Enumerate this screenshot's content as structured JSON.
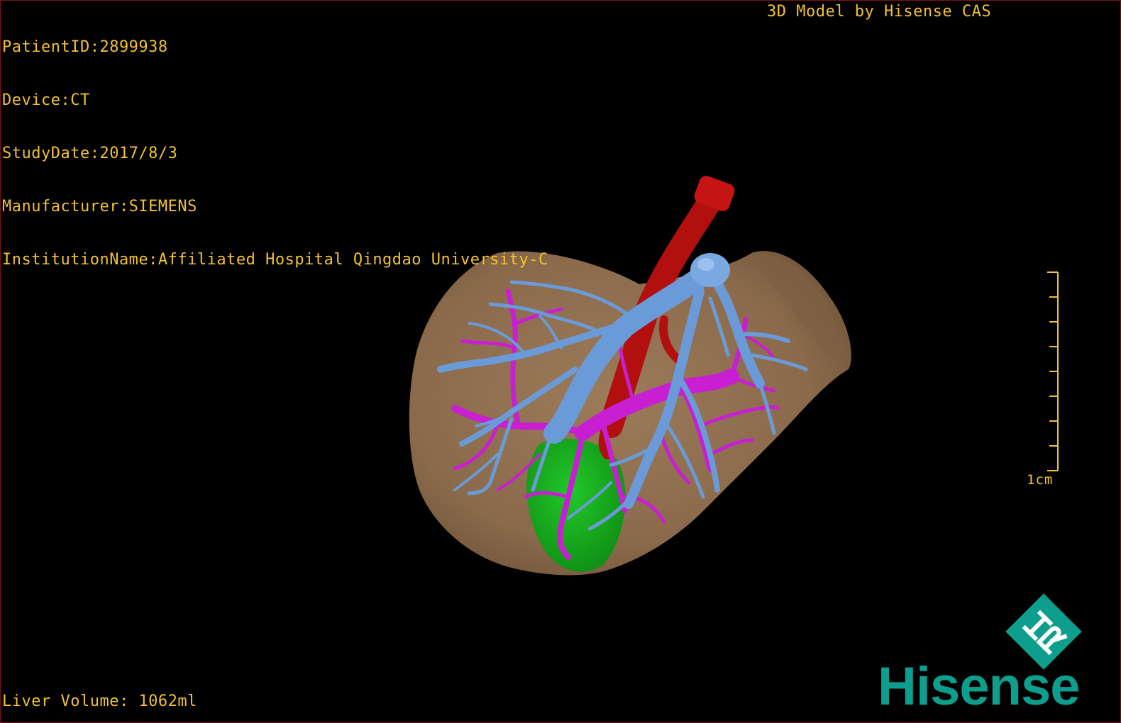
{
  "study": {
    "patient_id": "PatientID:2899938",
    "device": "Device:CT",
    "study_date": "StudyDate:2017/8/3",
    "manufacturer": "Manufacturer:SIEMENS",
    "institution": "InstitutionName:Affiliated Hospital Qingdao University-C"
  },
  "model_by": "3D Model by Hisense CAS",
  "liver_volume": "Liver Volume: 1062ml",
  "scale_bar": {
    "label": "1cm",
    "ticks": 9
  },
  "logo": {
    "word": "Hisense",
    "mark_letters": "HR"
  },
  "colors": {
    "text": "#f2c230",
    "liver": "#8f6e4e",
    "hepatic_vein": "#6a9bd8",
    "portal_vein": "#c81fd2",
    "artery": "#b20f0f",
    "gallbladder": "#18b41c",
    "brand": "#0d9e8e"
  }
}
